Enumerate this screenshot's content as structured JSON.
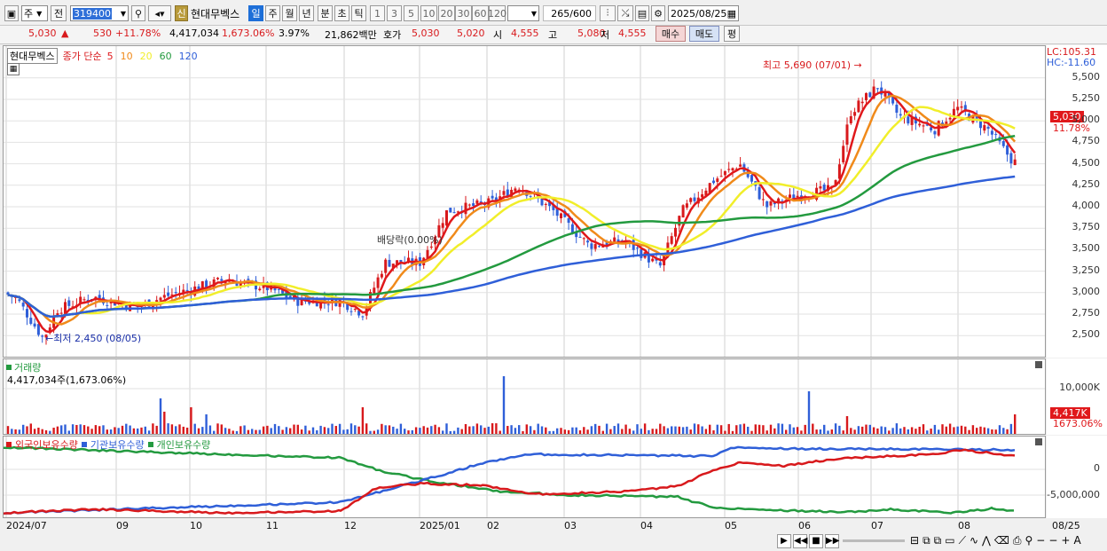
{
  "toolbar": {
    "type_select": "주",
    "prev_label": "전",
    "stock_code": "319400",
    "stock_name": "현대무벡스",
    "new_badge": "신",
    "periods": [
      "일",
      "주",
      "월",
      "년",
      "분",
      "초",
      "틱"
    ],
    "period_selected": "일",
    "counts": [
      "1",
      "3",
      "5",
      "10",
      "20",
      "30",
      "60",
      "120"
    ],
    "view_count": "265",
    "view_total": "/600",
    "date": "2025/08/25"
  },
  "quote": {
    "price": "5,030",
    "change": "530",
    "change_pct": "+11.78%",
    "volume": "4,417,034",
    "volume_ratio": "1,673.06%",
    "turnover": "3.97%",
    "amount": "21,862백만",
    "ask_label": "호가",
    "ask1": "5,030",
    "ask2": "5,020",
    "open_label": "시",
    "open": "4,555",
    "high_label": "고",
    "high": "5,080",
    "low_label": "저",
    "low": "4,555",
    "buy": "매수",
    "sell": "매도",
    "avg": "평"
  },
  "price_panel": {
    "stock_name": "현대무벡스",
    "legend_prefix": "종가 단순",
    "ma": [
      {
        "period": "5",
        "color": "#e0181b"
      },
      {
        "period": "10",
        "color": "#f08a1a"
      },
      {
        "period": "20",
        "color": "#f1ee2a"
      },
      {
        "period": "60",
        "color": "#239a3f"
      },
      {
        "period": "120",
        "color": "#2f5fd8"
      }
    ],
    "lc": "LC:105.31",
    "hc": "HC:-11.60",
    "y_ticks": [
      "5,500",
      "5,250",
      "5,000",
      "4,750",
      "4,500",
      "4,250",
      "4,000",
      "3,750",
      "3,500",
      "3,250",
      "3,000",
      "2,750",
      "2,500"
    ],
    "current_tag": "5,030",
    "current_pct": "11.78%",
    "high_note": "최고 5,690 (07/01)",
    "low_note": "최저 2,450 (08/05)",
    "dividend_note": "배당락(0.00%)"
  },
  "volume_panel": {
    "title": "거래량",
    "value": "4,417,034주(1,673.06%)",
    "y_tick": "10,000K",
    "current_tag": "4,417K",
    "current_pct": "1673.06%"
  },
  "holding_panel": {
    "legend": [
      "외국인보유수량",
      "기관보유수량",
      "개인보유수량"
    ],
    "legend_colors": [
      "#d8191c",
      "#2f5fd8",
      "#239a3f"
    ],
    "y_ticks": [
      "0",
      "-5,000,000"
    ]
  },
  "x_axis": {
    "labels": [
      "2024/07",
      "09",
      "10",
      "11",
      "12",
      "2025/01",
      "02",
      "03",
      "04",
      "05",
      "06",
      "07",
      "08"
    ],
    "right_label": "08/25"
  }
}
